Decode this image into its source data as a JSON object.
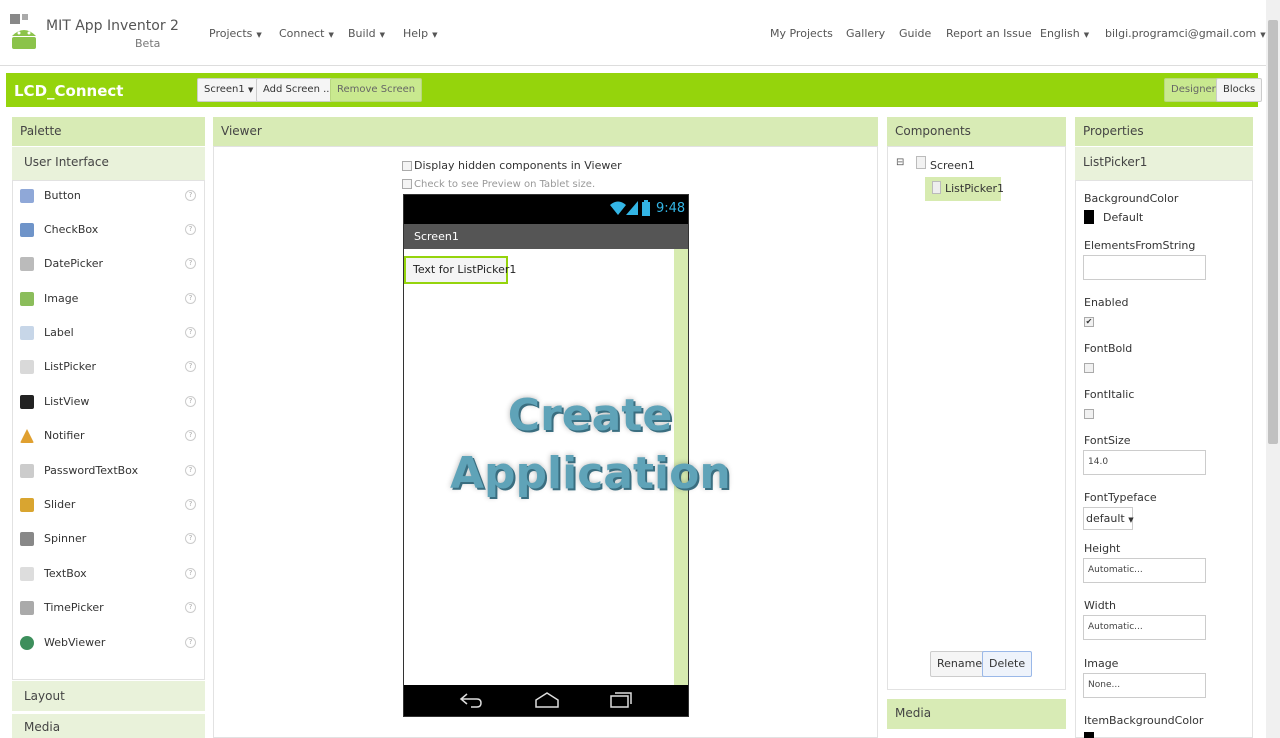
{
  "brand": {
    "title": "MIT App Inventor 2",
    "subtitle": "Beta"
  },
  "topnav": {
    "left": [
      "Projects",
      "Connect",
      "Build",
      "Help"
    ],
    "right": {
      "my_projects": "My Projects",
      "gallery": "Gallery",
      "guide": "Guide",
      "report": "Report an Issue",
      "language": "English",
      "account": "bilgi.programci@gmail.com"
    }
  },
  "project": {
    "name": "LCD_Connect",
    "screen_select": "Screen1",
    "add_screen": "Add Screen ...",
    "remove_screen": "Remove Screen",
    "designer": "Designer",
    "blocks": "Blocks"
  },
  "palette": {
    "title": "Palette",
    "section": "User Interface",
    "items": [
      {
        "label": "Button",
        "color": "#8fa8d8"
      },
      {
        "label": "CheckBox",
        "color": "#6f94c9"
      },
      {
        "label": "DatePicker",
        "color": "#bbbbbb"
      },
      {
        "label": "Image",
        "color": "#8bbd5b"
      },
      {
        "label": "Label",
        "color": "#c7d6e8"
      },
      {
        "label": "ListPicker",
        "color": "#d9d9d9"
      },
      {
        "label": "ListView",
        "color": "#222222"
      },
      {
        "label": "Notifier",
        "color": "#e0a030"
      },
      {
        "label": "PasswordTextBox",
        "color": "#cccccc"
      },
      {
        "label": "Slider",
        "color": "#d9a530"
      },
      {
        "label": "Spinner",
        "color": "#888888"
      },
      {
        "label": "TextBox",
        "color": "#dddddd"
      },
      {
        "label": "TimePicker",
        "color": "#aaaaaa"
      },
      {
        "label": "WebViewer",
        "color": "#3d8f5c"
      }
    ],
    "help_glyph": "?",
    "bottom_sections": [
      "Layout",
      "Media"
    ]
  },
  "viewer": {
    "title": "Viewer",
    "show_hidden": "Display hidden components in Viewer",
    "tablet_preview": "Check to see Preview on Tablet size.",
    "phone": {
      "time": "9:48",
      "screen_title": "Screen1",
      "listpicker_text": "Text for ListPicker1"
    },
    "overlay_line1": "Create",
    "overlay_line2": "Application"
  },
  "components": {
    "title": "Components",
    "tree": {
      "toggle": "⊟",
      "root": "Screen1",
      "child": "ListPicker1"
    },
    "rename": "Rename",
    "delete": "Delete",
    "media_title": "Media"
  },
  "properties": {
    "title": "Properties",
    "component": "ListPicker1",
    "bg_color_label": "BackgroundColor",
    "bg_color_value": "Default",
    "elements_label": "ElementsFromString",
    "elements_value": "",
    "enabled_label": "Enabled",
    "fontbold_label": "FontBold",
    "fontitalic_label": "FontItalic",
    "fontsize_label": "FontSize",
    "fontsize_value": "14.0",
    "typeface_label": "FontTypeface",
    "typeface_value": "default",
    "height_label": "Height",
    "height_value": "Automatic...",
    "width_label": "Width",
    "width_value": "Automatic...",
    "image_label": "Image",
    "image_value": "None...",
    "item_bg_label": "ItemBackgroundColor"
  },
  "colors": {
    "accent": "#95d40c",
    "panel_header": "#d8ebb5",
    "overlay_text": "#5fa3b8"
  }
}
